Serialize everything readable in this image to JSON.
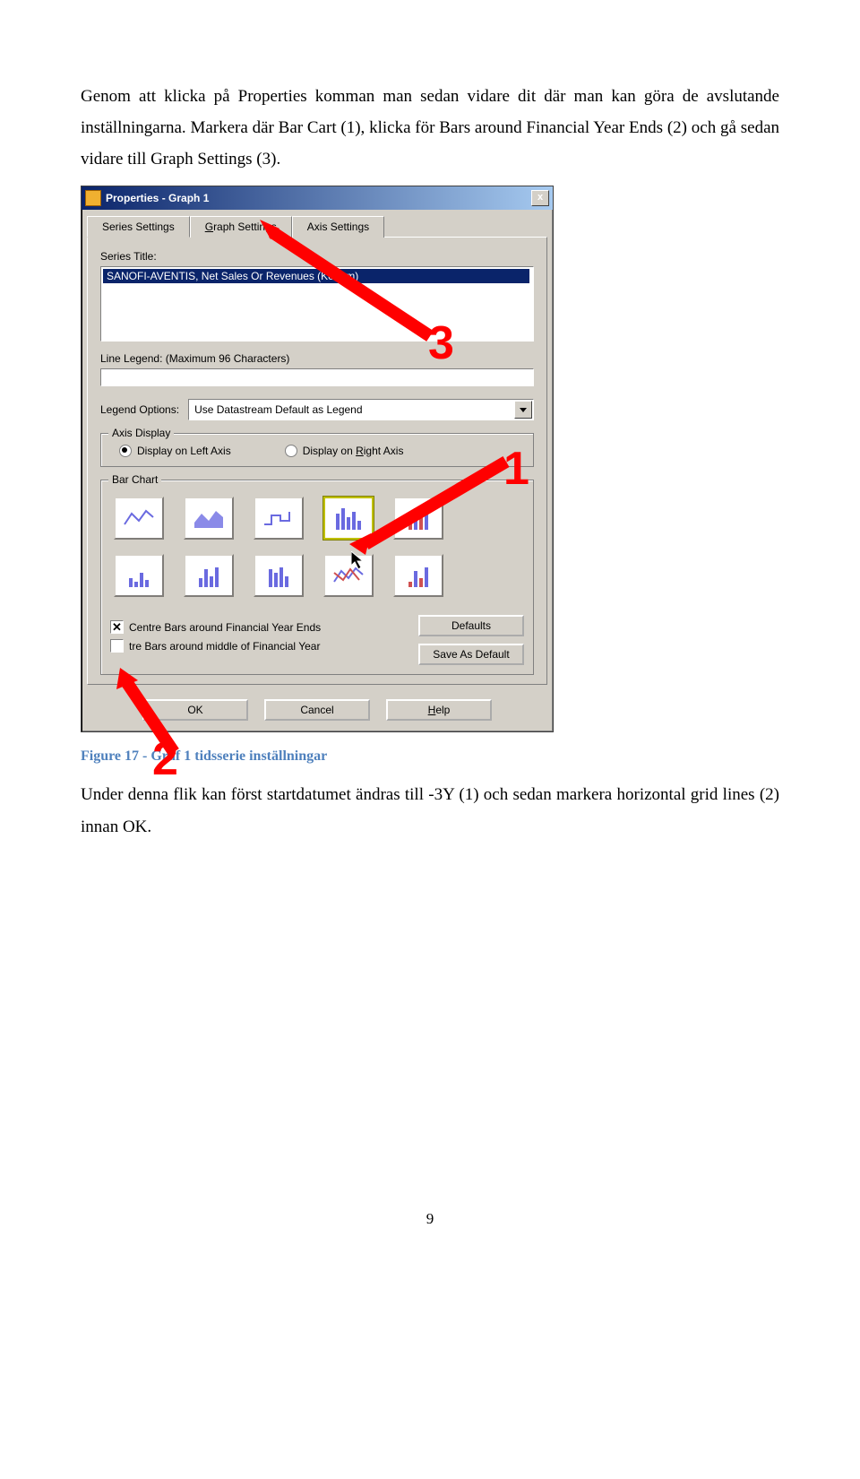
{
  "para1": "Genom att klicka på Properties komman man sedan vidare dit där man kan göra de avslutande inställningarna. Markera där Bar Cart (1), klicka för Bars around Financial Year Ends (2) och gå sedan vidare till Graph Settings (3).",
  "caption": "Figure 17 - Graf 1 tidsserie inställningar",
  "para2": "Under denna flik kan först startdatumet ändras till -3Y (1) och sedan markera horizontal grid lines (2) innan OK.",
  "pageNumber": "9",
  "dlg": {
    "title": "Properties - Graph 1",
    "close": "x",
    "tabs": {
      "t1": "Series Settings",
      "t2": "Graph Settings",
      "t3": "Axis Settings"
    },
    "seriesTitleLabel": "Series Title:",
    "seriesTitleValue": "SANOFI-AVENTIS, Net Sales Or Revenues (Ke   tem)",
    "lineLegendLabel": "Line Legend: (Maximum 96 Characters)",
    "legendOptionsLabel": "Legend Options:",
    "legendOptionsValue": "Use Datastream Default as Legend",
    "axisDisplay": "Axis Display",
    "leftAxis": "Display on Left Axis",
    "rightAxis": "Display on Right Axis",
    "barChart": "Bar Chart",
    "chk1": "Centre Bars around Financial Year Ends",
    "chk2": "tre Bars around middle of Financial Year",
    "defaults": "Defaults",
    "saveDefault": "Save As Default",
    "ok": "OK",
    "cancel": "Cancel",
    "help": "Help"
  },
  "overlay": {
    "n1": "1",
    "n2": "2",
    "n3": "3"
  }
}
